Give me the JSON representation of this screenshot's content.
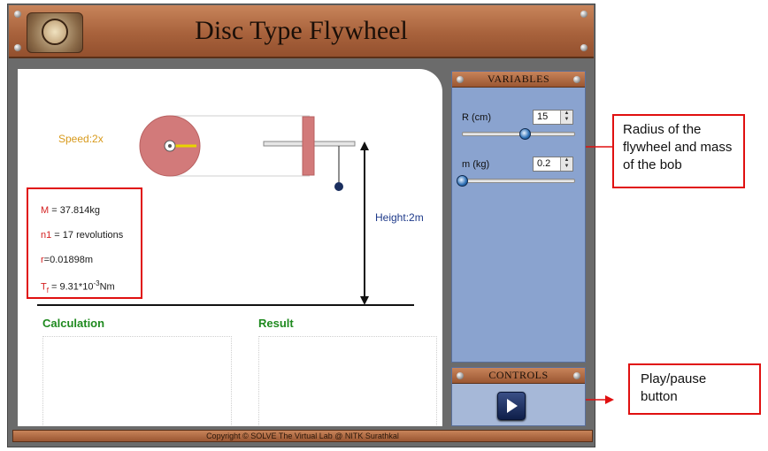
{
  "app": {
    "title": "Disc Type Flywheel",
    "footer": "Copyright © SOLVE The Virtual Lab @ NITK Surathkal"
  },
  "simulation": {
    "speed_label": "Speed:2x",
    "height_label": "Height:2m",
    "values": {
      "mass": {
        "symbol": "M",
        "text": " = 37.814kg"
      },
      "revolutions": {
        "symbol": "n1",
        "text": " = 17 revolutions"
      },
      "radius": {
        "symbol": "r",
        "text": "=0.01898m"
      },
      "torque": {
        "symbol": "T",
        "subscript": "f",
        "text": " = 9.31*10",
        "exponent": "-3",
        "unit": "Nm"
      }
    },
    "calculation_title": "Calculation",
    "result_title": "Result"
  },
  "variables_panel": {
    "header": "VARIABLES",
    "radius": {
      "label": "R (cm)",
      "value": "15",
      "slider_fraction": 0.55
    },
    "mass": {
      "label": "m (kg)",
      "value": "0.2",
      "slider_fraction": 0.0
    }
  },
  "controls_panel": {
    "header": "CONTROLS",
    "play_button_icon": "play-icon"
  },
  "annotations": {
    "variables_note": "Radius of the flywheel and mass of the bob",
    "play_note_line1": "Play/pause",
    "play_note_line2": "button"
  },
  "colors": {
    "wood": "#a8623c",
    "panel_blue": "#8aa3cf",
    "disc": "#d27a7a",
    "label_orange": "#d89a1c",
    "label_blue": "#1e3a8a",
    "title_green": "#1f8a1f",
    "annotation_red": "#e01010"
  }
}
